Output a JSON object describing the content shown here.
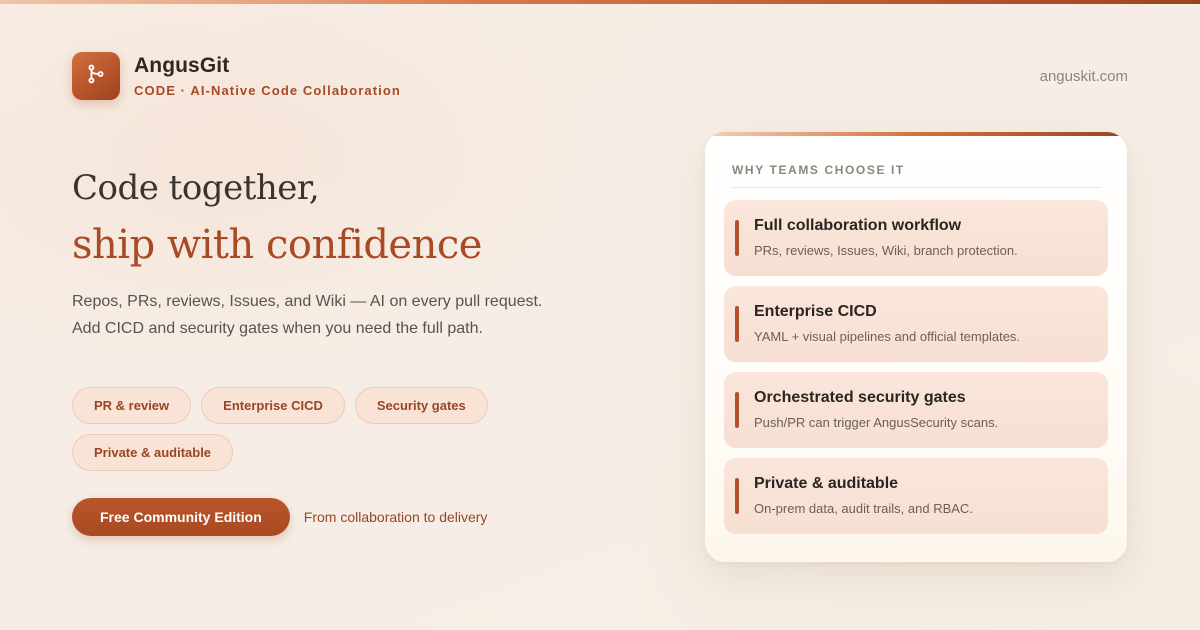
{
  "brand": {
    "name": "AngusGit",
    "tagline": "CODE · AI-Native Code Collaboration",
    "domain": "anguskit.com"
  },
  "hero": {
    "headline_line1": "Code together,",
    "headline_line2": "ship with confidence",
    "subtext_line1": "Repos, PRs, reviews, Issues, and Wiki — AI on every pull request.",
    "subtext_line2": "Add CICD and security gates when you need the full path."
  },
  "pills": [
    "PR & review",
    "Enterprise CICD",
    "Security gates",
    "Private & auditable"
  ],
  "cta": {
    "label": "Free Community Edition",
    "note": "From collaboration to delivery"
  },
  "card": {
    "title": "WHY TEAMS CHOOSE IT",
    "features": [
      {
        "title": "Full collaboration workflow",
        "desc": "PRs, reviews, Issues, Wiki, branch protection."
      },
      {
        "title": "Enterprise CICD",
        "desc": "YAML + visual pipelines and official templates."
      },
      {
        "title": "Orchestrated security gates",
        "desc": "Push/PR can trigger AngusSecurity scans."
      },
      {
        "title": "Private & auditable",
        "desc": "On-prem data, audit trails, and RBAC."
      }
    ]
  },
  "icons": {
    "logo": "git-branch-icon"
  },
  "colors": {
    "accent": "#a84a24",
    "pill_bg": "#f9e3d6",
    "feature_bg": "#f6dfd2",
    "background": "#f6eee6"
  }
}
